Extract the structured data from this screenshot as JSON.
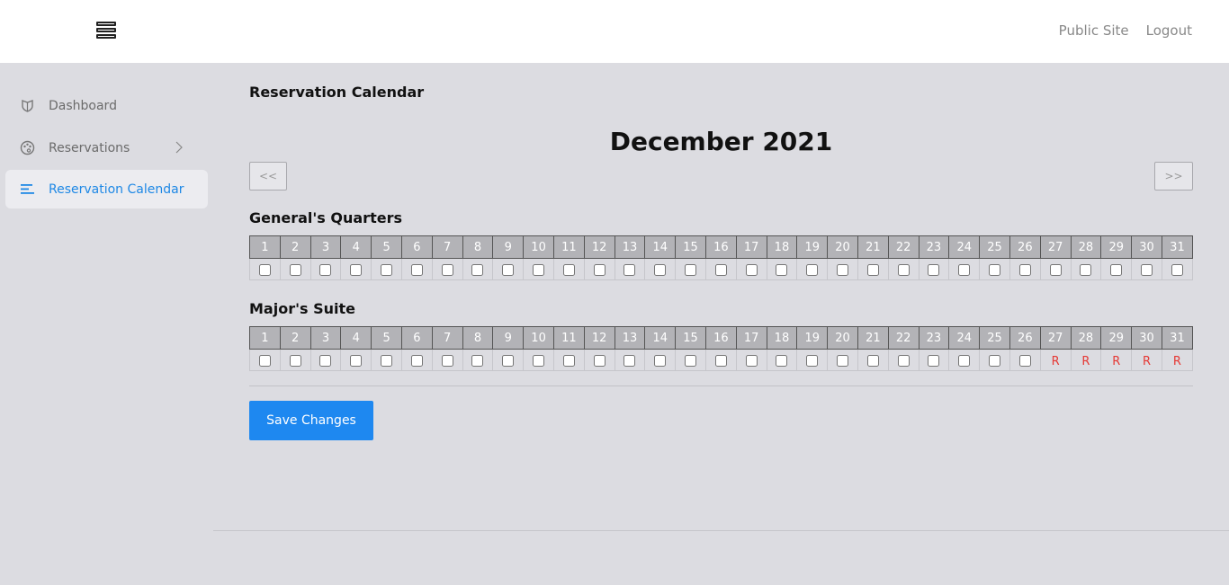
{
  "header": {
    "menu_icon": "hamburger-icon",
    "links": [
      "Public Site",
      "Logout"
    ]
  },
  "sidebar": {
    "items": [
      {
        "label": "Dashboard",
        "icon": "shield-icon",
        "active": false
      },
      {
        "label": "Reservations",
        "icon": "palette-icon",
        "active": false,
        "has_submenu": true
      },
      {
        "label": "Reservation Calendar",
        "icon": "text-lines-icon",
        "active": true
      }
    ]
  },
  "main": {
    "page_title": "Reservation Calendar",
    "month_title": "December 2021",
    "prev_label": "<<",
    "next_label": ">>",
    "save_label": "Save Changes",
    "reserved_marker": "R",
    "rooms": [
      {
        "name": "General's Quarters",
        "reserved_days": []
      },
      {
        "name": "Major's Suite",
        "reserved_days": [
          27,
          28,
          29,
          30,
          31
        ]
      }
    ],
    "days": [
      "1",
      "2",
      "3",
      "4",
      "5",
      "6",
      "7",
      "8",
      "9",
      "10",
      "11",
      "12",
      "13",
      "14",
      "15",
      "16",
      "17",
      "18",
      "19",
      "20",
      "21",
      "22",
      "23",
      "24",
      "25",
      "26",
      "27",
      "28",
      "29",
      "30",
      "31"
    ]
  },
  "colors": {
    "accent": "#1e88e5",
    "reserved": "#e53935",
    "header_cell": "#b3b3b7"
  }
}
